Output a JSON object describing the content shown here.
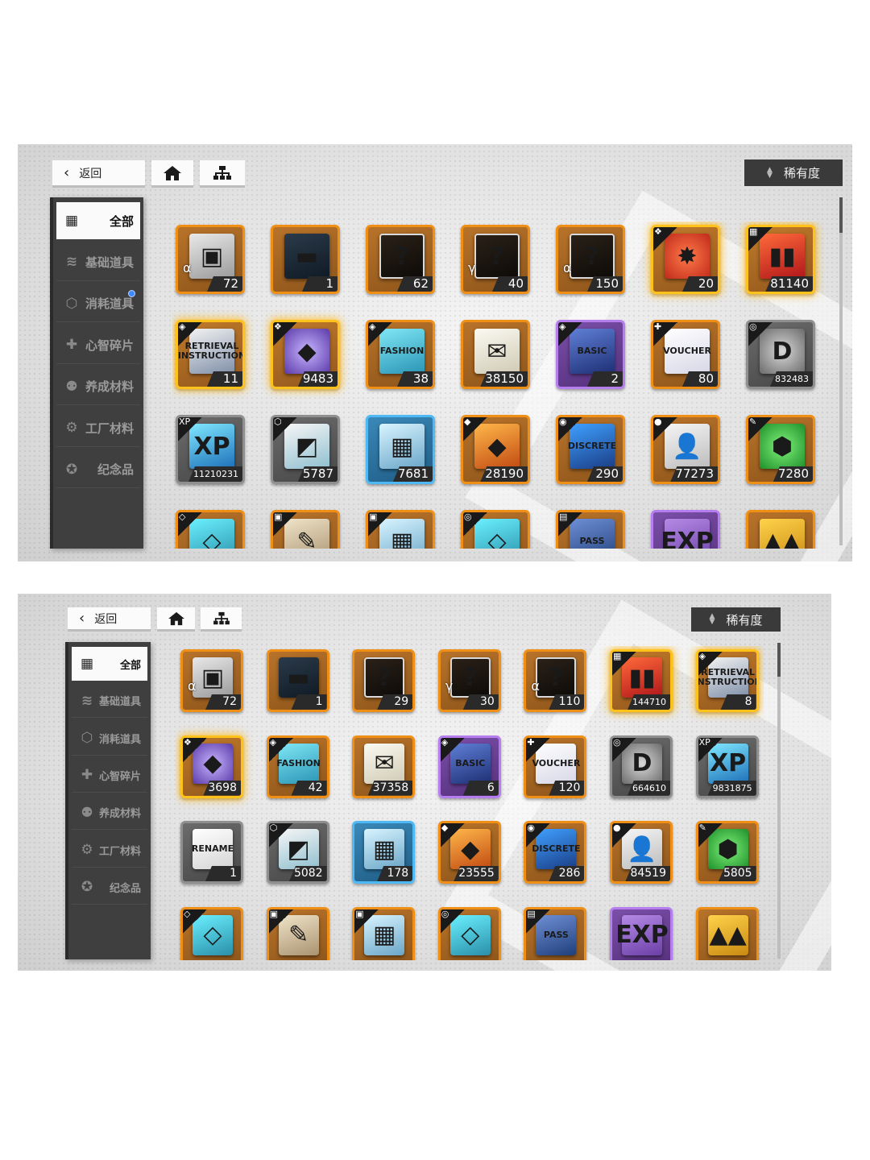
{
  "screens": [
    {
      "back_label": "返回",
      "home_icon": "home-icon",
      "tree_icon": "hierarchy-icon",
      "sort_label": "稀有度",
      "sort_icon": "sort-arrows-icon",
      "sidebar": [
        {
          "label": "全部",
          "icon": "grid-icon",
          "active": true,
          "badge": false
        },
        {
          "label": "基础道具",
          "icon": "layers-icon",
          "active": false,
          "badge": false
        },
        {
          "label": "消耗道具",
          "icon": "box-icon",
          "active": false,
          "badge": true
        },
        {
          "label": "心智碎片",
          "icon": "puzzle-icon",
          "active": false,
          "badge": false
        },
        {
          "label": "养成材料",
          "icon": "user-upgrade-icon",
          "active": false,
          "badge": false
        },
        {
          "label": "工厂材料",
          "icon": "gear-icon",
          "active": false,
          "badge": false
        },
        {
          "label": "纪念品",
          "icon": "medal-icon",
          "active": false,
          "badge": false
        }
      ],
      "scroll_position": 0.0,
      "items": [
        {
          "count": "72",
          "rarity": "orange",
          "art": "box",
          "badge": "α",
          "corner": ""
        },
        {
          "count": "1",
          "rarity": "orange",
          "art": "device",
          "badge": "",
          "corner": ""
        },
        {
          "count": "62",
          "rarity": "orange",
          "art": "mystery",
          "badge": "",
          "corner": ""
        },
        {
          "count": "40",
          "rarity": "orange",
          "art": "mystery",
          "badge": "γ",
          "corner": ""
        },
        {
          "count": "150",
          "rarity": "orange",
          "art": "mystery",
          "badge": "α",
          "corner": ""
        },
        {
          "count": "20",
          "rarity": "gold",
          "art": "red",
          "badge": "",
          "corner": "❖"
        },
        {
          "count": "81140",
          "rarity": "gold",
          "art": "bars",
          "badge": "",
          "corner": "▦"
        },
        {
          "count": "11",
          "rarity": "gold",
          "art": "ticket",
          "badge": "",
          "corner": "◈"
        },
        {
          "count": "9483",
          "rarity": "gold",
          "art": "cube",
          "badge": "",
          "corner": "❖"
        },
        {
          "count": "38",
          "rarity": "orange",
          "art": "fashion",
          "badge": "",
          "corner": "◈"
        },
        {
          "count": "38150",
          "rarity": "orange",
          "art": "letter",
          "badge": "",
          "corner": ""
        },
        {
          "count": "2",
          "rarity": "purple",
          "art": "basic",
          "badge": "",
          "corner": "◈"
        },
        {
          "count": "80",
          "rarity": "orange",
          "art": "voucher",
          "badge": "",
          "corner": "✚"
        },
        {
          "count": "832483",
          "rarity": "gray",
          "art": "coin",
          "badge": "",
          "corner": "◎"
        },
        {
          "count": "11210231",
          "rarity": "gray",
          "art": "xp",
          "badge": "",
          "corner": "XP"
        },
        {
          "count": "5787",
          "rarity": "gray",
          "art": "gift",
          "badge": "",
          "corner": "⬡"
        },
        {
          "count": "7681",
          "rarity": "blue",
          "art": "chip",
          "badge": "",
          "corner": ""
        },
        {
          "count": "28190",
          "rarity": "orange",
          "art": "crystal",
          "badge": "",
          "corner": "◆"
        },
        {
          "count": "290",
          "rarity": "orange",
          "art": "discrete",
          "badge": "",
          "corner": "◉"
        },
        {
          "count": "77273",
          "rarity": "orange",
          "art": "person",
          "badge": "",
          "corner": "●"
        },
        {
          "count": "7280",
          "rarity": "orange",
          "art": "hammer",
          "badge": "",
          "corner": "✎"
        },
        {
          "count": "",
          "rarity": "orange",
          "art": "cyan",
          "badge": "",
          "corner": "◇"
        },
        {
          "count": "",
          "rarity": "orange",
          "art": "scroll",
          "badge": "",
          "corner": "▣"
        },
        {
          "count": "",
          "rarity": "orange",
          "art": "chip",
          "badge": "",
          "corner": "▣"
        },
        {
          "count": "",
          "rarity": "orange",
          "art": "cyan",
          "badge": "",
          "corner": "◎"
        },
        {
          "count": "",
          "rarity": "orange",
          "art": "pass",
          "badge": "",
          "corner": "▤"
        },
        {
          "count": "",
          "rarity": "purple",
          "art": "exp",
          "badge": "",
          "corner": ""
        },
        {
          "count": "",
          "rarity": "orange",
          "art": "shards",
          "badge": "",
          "corner": ""
        }
      ]
    },
    {
      "back_label": "返回",
      "home_icon": "home-icon",
      "tree_icon": "hierarchy-icon",
      "sort_label": "稀有度",
      "sort_icon": "sort-arrows-icon",
      "sidebar": [
        {
          "label": "全部",
          "icon": "grid-icon",
          "active": true,
          "badge": false
        },
        {
          "label": "基础道具",
          "icon": "layers-icon",
          "active": false,
          "badge": false
        },
        {
          "label": "消耗道具",
          "icon": "box-icon",
          "active": false,
          "badge": false
        },
        {
          "label": "心智碎片",
          "icon": "puzzle-icon",
          "active": false,
          "badge": false
        },
        {
          "label": "养成材料",
          "icon": "user-upgrade-icon",
          "active": false,
          "badge": false
        },
        {
          "label": "工厂材料",
          "icon": "gear-icon",
          "active": false,
          "badge": false
        },
        {
          "label": "纪念品",
          "icon": "medal-icon",
          "active": false,
          "badge": false
        }
      ],
      "scroll_position": 0.0,
      "items": [
        {
          "count": "72",
          "rarity": "orange",
          "art": "box",
          "badge": "α",
          "corner": ""
        },
        {
          "count": "1",
          "rarity": "orange",
          "art": "device",
          "badge": "",
          "corner": ""
        },
        {
          "count": "29",
          "rarity": "orange",
          "art": "mystery",
          "badge": "",
          "corner": ""
        },
        {
          "count": "30",
          "rarity": "orange",
          "art": "mystery",
          "badge": "γ",
          "corner": ""
        },
        {
          "count": "110",
          "rarity": "orange",
          "art": "mystery",
          "badge": "α",
          "corner": ""
        },
        {
          "count": "144710",
          "rarity": "gold",
          "art": "bars",
          "badge": "",
          "corner": "▦"
        },
        {
          "count": "8",
          "rarity": "gold",
          "art": "ticket",
          "badge": "",
          "corner": "◈"
        },
        {
          "count": "3698",
          "rarity": "gold",
          "art": "cube",
          "badge": "",
          "corner": "❖"
        },
        {
          "count": "42",
          "rarity": "orange",
          "art": "fashion",
          "badge": "",
          "corner": "◈"
        },
        {
          "count": "37358",
          "rarity": "orange",
          "art": "letter",
          "badge": "",
          "corner": ""
        },
        {
          "count": "6",
          "rarity": "purple",
          "art": "basic",
          "badge": "",
          "corner": "◈"
        },
        {
          "count": "120",
          "rarity": "orange",
          "art": "voucher",
          "badge": "",
          "corner": "✚"
        },
        {
          "count": "664610",
          "rarity": "gray",
          "art": "coin",
          "badge": "",
          "corner": "◎"
        },
        {
          "count": "9831875",
          "rarity": "gray",
          "art": "xp",
          "badge": "",
          "corner": "XP"
        },
        {
          "count": "1",
          "rarity": "gray",
          "art": "rename",
          "badge": "",
          "corner": ""
        },
        {
          "count": "5082",
          "rarity": "gray",
          "art": "gift",
          "badge": "",
          "corner": "⬡"
        },
        {
          "count": "178",
          "rarity": "blue",
          "art": "chip",
          "badge": "",
          "corner": ""
        },
        {
          "count": "23555",
          "rarity": "orange",
          "art": "crystal",
          "badge": "",
          "corner": "◆"
        },
        {
          "count": "286",
          "rarity": "orange",
          "art": "discrete",
          "badge": "",
          "corner": "◉"
        },
        {
          "count": "84519",
          "rarity": "orange",
          "art": "person",
          "badge": "",
          "corner": "●"
        },
        {
          "count": "5805",
          "rarity": "orange",
          "art": "hammer",
          "badge": "",
          "corner": "✎"
        },
        {
          "count": "",
          "rarity": "orange",
          "art": "cyan",
          "badge": "",
          "corner": "◇"
        },
        {
          "count": "",
          "rarity": "orange",
          "art": "scroll",
          "badge": "",
          "corner": "▣"
        },
        {
          "count": "",
          "rarity": "orange",
          "art": "chip",
          "badge": "",
          "corner": "▣"
        },
        {
          "count": "",
          "rarity": "orange",
          "art": "cyan",
          "badge": "",
          "corner": "◎"
        },
        {
          "count": "",
          "rarity": "orange",
          "art": "pass",
          "badge": "",
          "corner": "▤"
        },
        {
          "count": "",
          "rarity": "purple",
          "art": "exp",
          "badge": "",
          "corner": ""
        },
        {
          "count": "",
          "rarity": "orange",
          "art": "shards",
          "badge": "",
          "corner": ""
        }
      ]
    }
  ],
  "art_text": {
    "box": "▣",
    "device": "▬",
    "mystery": "?",
    "red": "✸",
    "bars": "▮▮",
    "ticket": "RETRIEVAL INSTRUCTION",
    "cube": "◆",
    "fashion": "FASHION",
    "letter": "✉",
    "basic": "BASIC",
    "voucher": "VOUCHER",
    "coin": "D",
    "xp": "XP",
    "gift": "◩",
    "chip": "▦",
    "crystal": "◆",
    "discrete": "DISCRETE",
    "person": "👤",
    "hammer": "⬢",
    "rename": "RENAME",
    "cyan": "◇",
    "scroll": "✎",
    "pass": "PASS",
    "exp": "EXP",
    "shards": "▲▲"
  }
}
